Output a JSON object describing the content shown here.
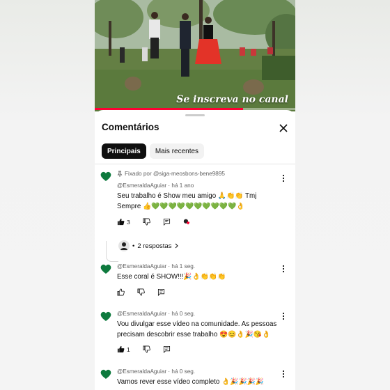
{
  "video": {
    "overlay_text": "Se inscreva no canal",
    "progress_fraction": 0.74,
    "accent": "#ff0033"
  },
  "sheet": {
    "title": "Comentários",
    "close_icon": "close-icon",
    "filters": [
      {
        "label": "Principais",
        "active": true
      },
      {
        "label": "Mais recentes",
        "active": false
      }
    ]
  },
  "comments": [
    {
      "pinned_label": "Fixado por @siga-meosbons-bene9895",
      "author": "@EsmeraldaAguiar",
      "time": "há 1 ano",
      "meta": "@EsmeraldaAguiar · há 1 ano",
      "text": "Seu trabalho é Show meu amigo 🙏👏👏 Tmj Sempre 👍💚💚💚💚💚💚💚💚💚💚👌",
      "likes": "3",
      "reply_label": "2 respostas"
    },
    {
      "meta": "@EsmeraldaAguiar · há 1 seg.",
      "text": "Esse coral é SHOW!!!🎉👌👏👏👏",
      "likes": ""
    },
    {
      "meta": "@EsmeraldaAguiar · há 0 seg.",
      "text": "Vou divulgar esse vídeo na comunidade. As pessoas precisam descobrir esse trabalho 😍😊👌🎉😘👌",
      "likes": "1"
    },
    {
      "meta": "@EsmeraldaAguiar · há 0 seg.",
      "text": "Vamos rever esse vídeo completo 👌🎉🎉🎉🎉"
    }
  ],
  "colors": {
    "avatar_green": "#0e7a3e",
    "text_primary": "#0f0f0f",
    "text_secondary": "#606060"
  }
}
